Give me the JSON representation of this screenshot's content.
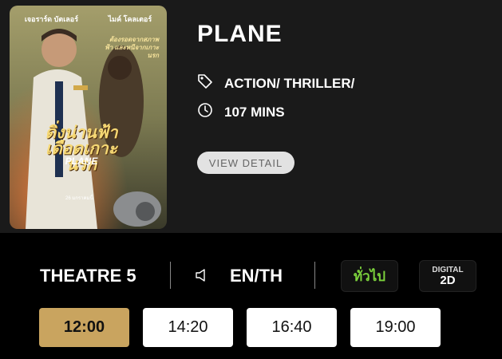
{
  "poster": {
    "actor_left": "เจอราร์ด บัตเลอร์",
    "actor_right": "ไมค์ โคลเตอร์",
    "tagline": "ต้องรอดจากสภาพฟ้า และหนีจากเกาะนรก",
    "thai_title": "ดิ่งน่านฟ้า เดือดเกาะนรก",
    "english_title": "PLANE",
    "release_date": "26 มกราคมนี้"
  },
  "movie": {
    "title": "PLANE",
    "genre": "ACTION/ THRILLER/",
    "duration": "107 MINS",
    "view_detail_label": "VIEW DETAIL"
  },
  "theatre": {
    "name": "THEATRE 5",
    "language": "EN/TH",
    "rating_badge": "ทั่วไป",
    "format_badge_top": "DIGITAL",
    "format_badge_bottom": "2D"
  },
  "showtimes": [
    {
      "time": "12:00",
      "selected": true
    },
    {
      "time": "14:20",
      "selected": false
    },
    {
      "time": "16:40",
      "selected": false
    },
    {
      "time": "19:00",
      "selected": false
    }
  ],
  "colors": {
    "selected_time": "#c9a45f",
    "general_rating": "#7cd23c",
    "info_panel": "#1a1a1a"
  }
}
